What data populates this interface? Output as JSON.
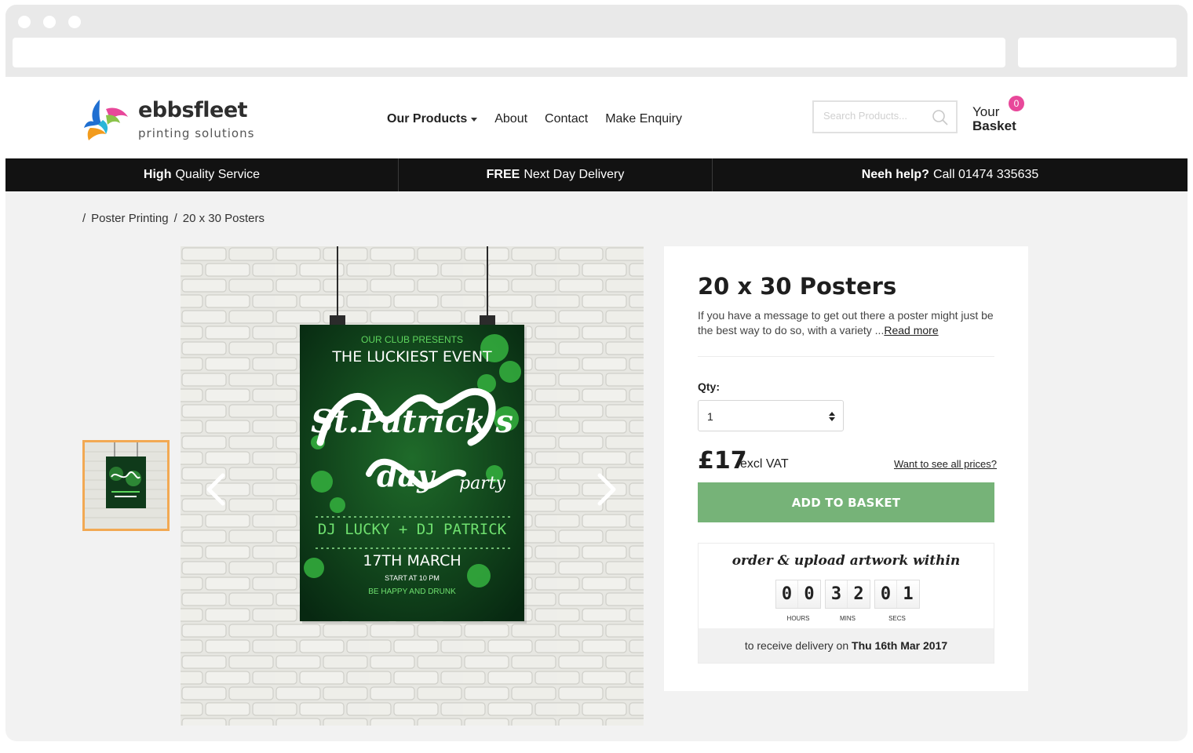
{
  "brand": {
    "name": "ebbsfleet",
    "tagline": "printing solutions"
  },
  "nav": {
    "items": [
      {
        "label": "Our Products"
      },
      {
        "label": "About"
      },
      {
        "label": "Contact"
      },
      {
        "label": "Make Enquiry"
      }
    ]
  },
  "search": {
    "placeholder": "Search Products..."
  },
  "basket": {
    "your": "Your",
    "label": "Basket",
    "count": "0"
  },
  "promo": {
    "quality_bold": "High",
    "quality_rest": "Quality Service",
    "delivery_bold": "FREE",
    "delivery_rest": "Next Day Delivery",
    "help_bold": "Neeh help?",
    "help_rest": "Call 01474 335635"
  },
  "breadcrumb": {
    "sep": "/",
    "level1": "Poster Printing",
    "level2": "20 x 30 Posters"
  },
  "poster": {
    "presents": "OUR CLUB PRESENTS",
    "event": "THE LUCKIEST EVENT",
    "script1": "St.Patrick's",
    "script2": "day",
    "script3": "party",
    "djs": "DJ LUCKY + DJ PATRICK",
    "date": "17TH MARCH",
    "start": "START AT 10 PM",
    "slogan": "BE HAPPY AND DRUNK"
  },
  "product": {
    "title": "20 x 30 Posters",
    "description": "If you have a message to get out there a poster might just be the best way to do so, with a variety ...",
    "read_more": "Read more",
    "qty_label": "Qty:",
    "qty_value": "1",
    "price": "£17",
    "vat": "excl VAT",
    "all_prices": "Want to see all prices?",
    "add_button": "ADD TO BASKET"
  },
  "countdown": {
    "title": "order & upload artwork within",
    "hours": [
      "0",
      "0"
    ],
    "mins": [
      "3",
      "2"
    ],
    "secs": [
      "0",
      "1"
    ],
    "hours_label": "HOURS",
    "mins_label": "MINS",
    "secs_label": "SECS",
    "delivery_prefix": "to receive delivery on",
    "delivery_date": "Thu 16th Mar 2017"
  },
  "colors": {
    "accent_green": "#76b378",
    "basket_badge": "#e8489a",
    "thumb_border": "#f2a953",
    "promo_bg": "#121212"
  }
}
